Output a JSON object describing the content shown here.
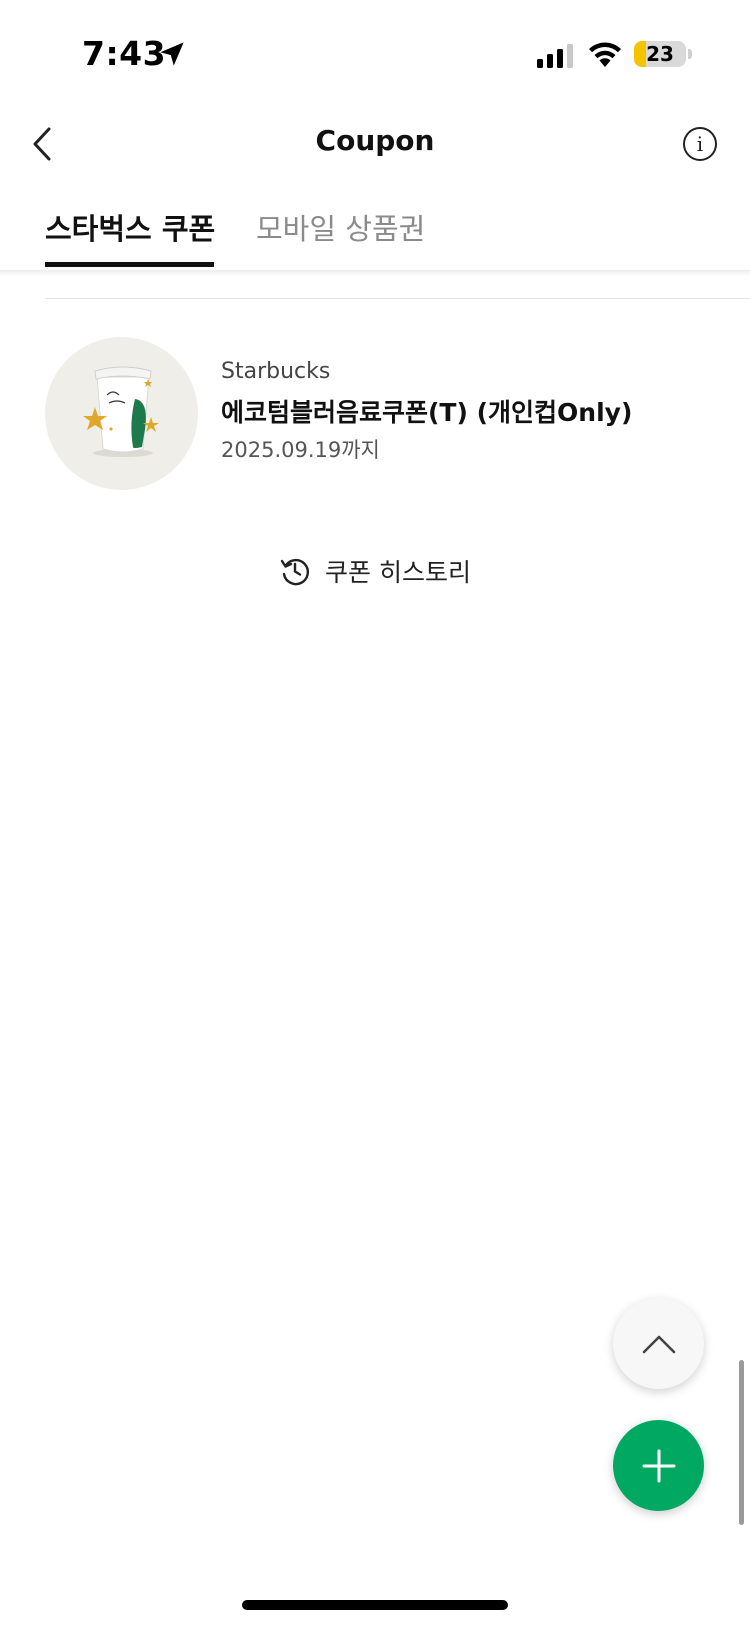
{
  "status_bar": {
    "time": "7:43",
    "battery": "23",
    "battery_level_percent": 23,
    "battery_color": "#f5c400"
  },
  "header": {
    "title": "Coupon",
    "back_icon": "chevron-left-icon",
    "info_icon": "info-icon"
  },
  "tabs": [
    {
      "label": "스타벅스 쿠폰",
      "active": true
    },
    {
      "label": "모바일 상품권",
      "active": false
    }
  ],
  "coupons": [
    {
      "brand": "Starbucks",
      "name": "에코텀블러음료쿠폰(T) (개인컵Only)",
      "expiry": "2025.09.19까지",
      "image": "tumbler-cup-with-stars"
    }
  ],
  "history": {
    "label": "쿠폰 히스토리",
    "icon": "history-clock-icon"
  },
  "fab": {
    "scroll_top_icon": "chevron-up-icon",
    "add_icon": "plus-icon",
    "accent_color": "#00a862"
  }
}
